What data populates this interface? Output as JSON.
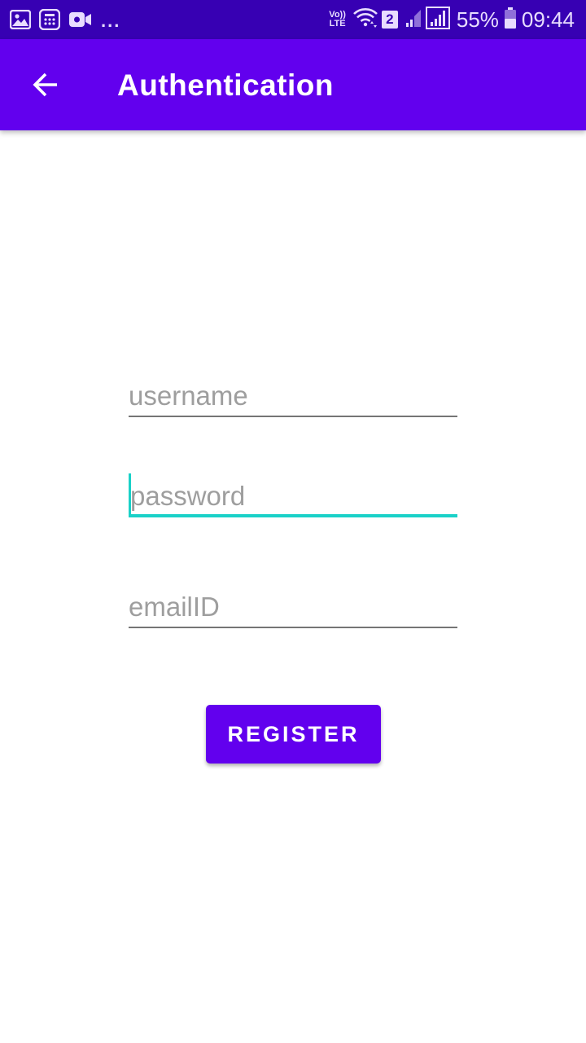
{
  "status_bar": {
    "left_icons": [
      "gallery-icon",
      "calculator-icon",
      "video-camera-icon"
    ],
    "more_indicator": "...",
    "volte_top": "Vo))",
    "volte_bottom": "LTE",
    "sim_number": "2",
    "battery_percent": "55%",
    "time": "09:44"
  },
  "app_bar": {
    "back_icon": "arrow-back-icon",
    "title": "Authentication",
    "background_color": "#6200ee"
  },
  "form": {
    "username_placeholder": "username",
    "password_placeholder": "password",
    "email_placeholder": "emailID",
    "focused_field": "password",
    "accent_color": "#1ad1c8"
  },
  "actions": {
    "register_label": "REGISTER"
  }
}
